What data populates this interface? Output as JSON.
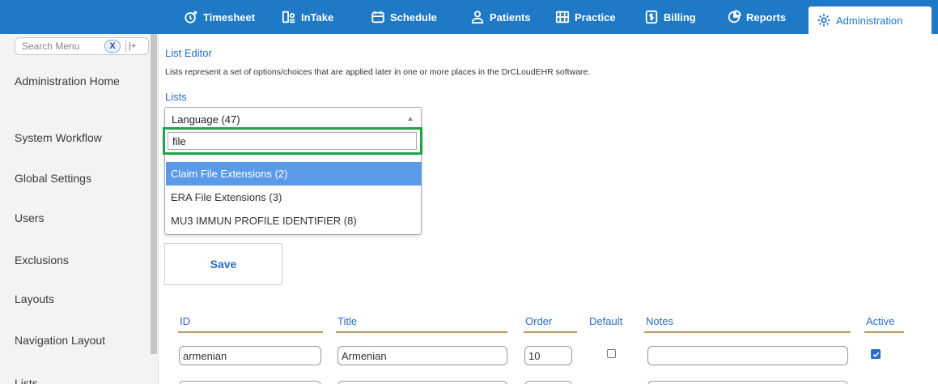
{
  "nav": {
    "items": [
      {
        "label": "Timesheet",
        "icon": "clock-plus-icon"
      },
      {
        "label": "InTake",
        "icon": "intake-icon"
      },
      {
        "label": "Schedule",
        "icon": "calendar-icon"
      },
      {
        "label": "Patients",
        "icon": "person-icon"
      },
      {
        "label": "Practice",
        "icon": "building-icon"
      },
      {
        "label": "Billing",
        "icon": "dollar-doc-icon"
      },
      {
        "label": "Reports",
        "icon": "pie-chart-icon"
      },
      {
        "label": "Administration",
        "icon": "gear-icon",
        "active": true
      }
    ]
  },
  "sidebar": {
    "search_placeholder": "Search Menu",
    "clear_label": "X",
    "pin_label": "|+",
    "items": [
      "Administration Home",
      "System Workflow",
      "Global Settings",
      "Users",
      "Exclusions",
      "Layouts",
      "Navigation Layout",
      "Lists"
    ]
  },
  "editor": {
    "title": "List Editor",
    "description": "Lists represent a set of options/choices that are applied later in one or more places in the DrCLoudEHR software.",
    "lists_label": "Lists",
    "selected_list": "Language (47)",
    "filter_value": "file",
    "options": [
      {
        "label": "Claim File Extensions (2)",
        "selected": true
      },
      {
        "label": "ERA File Extensions (3)",
        "selected": false
      },
      {
        "label": "MU3 IMMUN PROFILE IDENTIFIER (8)",
        "selected": false
      }
    ],
    "save_label": "Save"
  },
  "table": {
    "columns": [
      "ID",
      "Title",
      "Order",
      "Default",
      "Notes",
      "Active"
    ],
    "rows": [
      {
        "id": "armenian",
        "title": "Armenian",
        "order": "10",
        "default": false,
        "notes": "",
        "active": true
      }
    ]
  },
  "colors": {
    "nav_bg": "#1e79c7",
    "accent": "#2a6cc4",
    "highlight": "#22a24a",
    "selected_option": "#5b9ae6"
  }
}
